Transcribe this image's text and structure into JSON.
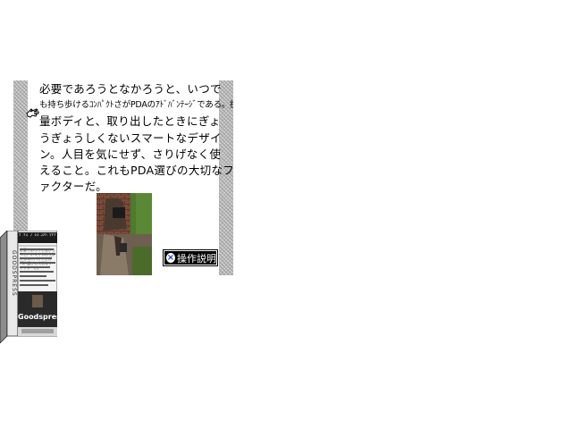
{
  "article": {
    "lines": [
      "必要であろうとなかろうと、いつで",
      "も持ち歩けるｺﾝﾊﾟｸﾄさがPDAのｱﾄﾞﾊﾞﾝﾃｰｼﾞである。携帯が苦にならない軽",
      "量ボディと、取り出したときにぎょ",
      "うぎょうしくないスマートなデザイ",
      "ン。人目を気にせず、さりげなく使",
      "えること。これもPDA選びの大切なフ",
      "ァクターだ。"
    ]
  },
  "ops_button": {
    "label": "操作説明",
    "icon": "x-circle-icon"
  },
  "magazine": {
    "brand": "Goodspress",
    "side_title": "GOODSPRESS",
    "header": "ｸﾞｯｽﾞﾌﾟﾚｽ ｺﾝﾊﾟｸﾄﾃﾞﾊﾞｲｽ",
    "intro_text": "必要であろうとなかろうと、いつでも持ち歩けるコンパクトさがPDA選びの大切なファクターだ。"
  },
  "colors": {
    "rail": "#bdbdbd",
    "button_bg": "#000000",
    "button_icon": "#1a3fbf",
    "magazine_dark": "#1c1c1c"
  }
}
